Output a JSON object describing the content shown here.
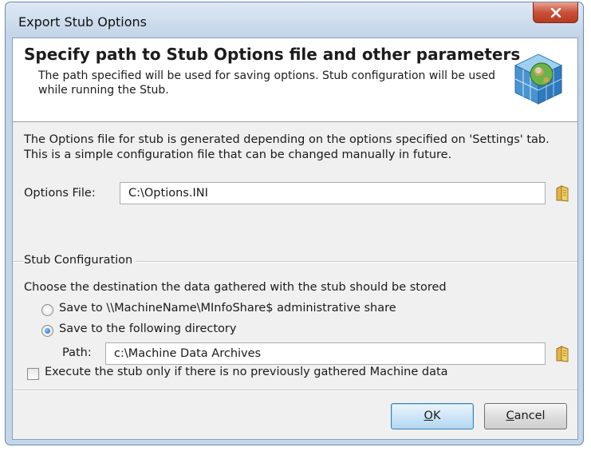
{
  "window": {
    "title": "Export Stub Options"
  },
  "header": {
    "title": "Specify path to Stub Options file and other parameters",
    "description": "The path specified will be used for saving options. Stub configuration will be used while running the Stub."
  },
  "intro": "The Options file for stub is generated depending on the options specified on 'Settings' tab. This is a simple configuration file that can be changed manually in future.",
  "options_file": {
    "label": "Options File:",
    "value": "C:\\Options.INI"
  },
  "stub_config": {
    "group_label": "Stub Configuration",
    "prompt": "Choose the destination the data gathered with the stub should be stored",
    "radio_share_label": "Save to \\\\MachineName\\MInfoShare$ administrative share",
    "radio_share_checked": false,
    "radio_dir_label": "Save to the following directory",
    "radio_dir_checked": true,
    "path_label": "Path:",
    "path_value": "c:\\Machine Data Archives"
  },
  "execute_check": {
    "label": "Execute the stub only if there is no previously gathered Machine data",
    "checked": false
  },
  "buttons": {
    "ok_mnemonic": "O",
    "ok_rest": "K",
    "cancel_mnemonic": "C",
    "cancel_rest": "ancel"
  },
  "icons": {
    "close": "close-icon",
    "header": "cube-globe-icon",
    "browse": "folder-icon"
  }
}
